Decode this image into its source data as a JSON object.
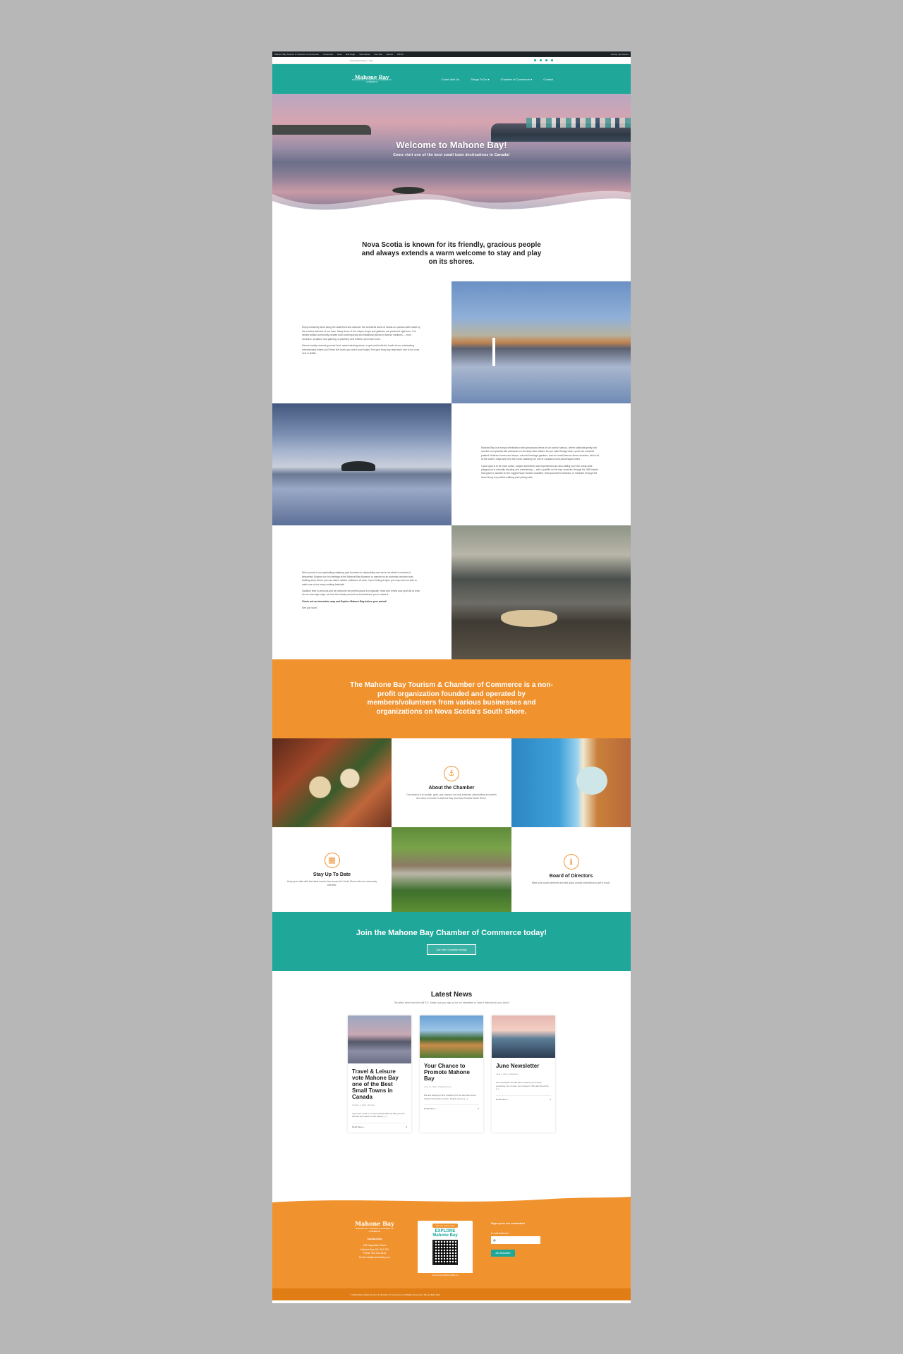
{
  "admin_bar": {
    "site": "Mahone Bay Tourism & Chamber of Commerce",
    "customize": "Customize",
    "new": "New",
    "edit_page": "Edit Page",
    "items": [
      "Visit Cache",
      "Live Site",
      "Events",
      "WPFO"
    ],
    "greeting": "Howdy, Speropoint"
  },
  "topbar": {
    "address": "8 Pleasant Street, 1 Fall"
  },
  "nav": {
    "logo_main": "Mahone Bay",
    "logo_sub": "MAHONE BAY TOURISM & CHAMBER OF COMMERCE",
    "links": [
      "Come Visit Us",
      "Things To Do ▾",
      "Chamber of Commerce ▾",
      "Contact"
    ]
  },
  "hero": {
    "title": "Welcome to Mahone Bay!",
    "subtitle": "Come visit one of the best small town destinations in Canada!"
  },
  "intro": "Nova Scotia is known for its friendly, gracious people and always extends a warm welcome to stay and play on its shores.",
  "section1": {
    "p1": "Enjoy a leisurely stroll along the waterfront and discover the wonderful world of hands-on special crafts made by the creative artisans of our town. Many items of the unique shops and galleries are produced right here. Our vibrant artistic community creates both contemporary and traditional pieces in diverse mediums — from ceramics, sculpture and painting, to jewellery and textiles, and much more.",
    "p2": "Savour locally sourced gourmet food, award-winning wines, or get social with the locals at our outstanding microbrewery where you'll hear live music you won't soon forget. End your busy day relaxing in one of our cozy inns or B&Bs."
  },
  "section2": {
    "p1": "Mahone Bay is a tranquil destination with spectacular views of our scenic harbour, where sailboats gently bob and the sun sparkles like diamonds on the deep blue waters. As you walk through town, you'll see colourful painted Victorian homes and shops, colourful heritage gardens, and our world-famous three churches, which sit at the water's edge and form the iconic backdrop for one of Canada's most picturesque towns.",
    "p2": "If your goal is to be more active, unique adventures and experiences are also calling you! Our ocean-side playground is naturally dazzling and entertaining — sail or paddle on the bay, meander through the 365 islands that grace it, wander on the rugged Nova Scotian coastline, treat yourself to beaches, or meander through the trees along our pristine walking and cycling trails."
  },
  "section3": {
    "p1": "We're proud of our captivating seafaring past founded on shipbuilding and we're not afraid to mention it frequently! Explore our rich heritage at the Mahone Bay Museum or wander by an authentic wooden boat-building shop where you can watch master craftsmen at work. If your timing is right, you may even be able to catch one of our many exciting festivals!",
    "p2": "Vacation time is precious and we welcome the perfect place to invigorate, relax and renew your spirit all at once. As our town sign says, we love the beauty around us and welcome you to share it.",
    "link": "Check out an interactive map and Explore Mahone Bay before your arrival!",
    "signoff": "See you soon!"
  },
  "mission": "The Mahone Bay Tourism & Chamber of Commerce is a non-profit organization founded and operated by members/volunteers from various businesses and organizations on Nova Scotia's South Shore.",
  "features": {
    "about": {
      "title": "About the Chamber",
      "text": "Our mission is to sustain, grow, and connect our local business communities and enrich the value of tourism in Mahone Bay and Nova Scotia's South Shore."
    },
    "stay": {
      "title": "Stay Up To Date",
      "text": "Keep up to date with the latest events from across the South Shore with our community calendar."
    },
    "board": {
      "title": "Board of Directors",
      "text": "Meet your board members and find quick contact information to get in touch."
    }
  },
  "join": {
    "title": "Join the Mahone Bay Chamber of Commerce today!",
    "button": "Join the Chamber today!"
  },
  "news": {
    "title": "Latest News",
    "lead": "The latest news from the MBTCC. Make sure you sign up for our newsletter to have it delivered to your inbox!",
    "posts": [
      {
        "title": "Travel & Leisure vote Mahone Bay one of the Best Small Towns in Canada",
        "meta": "October 3, 2021  |  Tourism",
        "excerpt": "If you live, lived in or have visited Mahone Bay you are already well aware of the beauty [...]",
        "more": "Read More »",
        "comments": "0"
      },
      {
        "title": "Your Chance to Promote Mahone Bay",
        "meta": "June 11, 2021  |  Chamber News",
        "excerpt": "We are looking to fill 2 positions for the summer at our Visitor Information Centre. Details can be [...]",
        "more": "Read More »",
        "comments": "0"
      },
      {
        "title": "June Newsletter",
        "meta": "June 1, 2021  |  Newsletter",
        "excerpt": "Our newsletter should have reached your inbox yesterday, but in case you missed it. We talk about the [...]",
        "more": "Read More »",
        "comments": "0"
      }
    ]
  },
  "footer": {
    "logo_main": "Mahone Bay",
    "logo_sub": "MAHONE BAY TOURISM & CHAMBER OF COMMERCE",
    "contact_title": "Contact Info",
    "address1": "165 Edgewater Street",
    "address2": "Mahone Bay, NS, B0J 2E0",
    "phone": "Phone: 902-624-6151",
    "email": "Email: info@mahonebay.com",
    "qr_top": "Visit our online map!",
    "qr_title1": "EXPLORE",
    "qr_title2": "Mahone Bay",
    "qr_url": "www.ExploreMahoneBay.ca",
    "signup_title": "Sign up for our newsletter!",
    "email_label": "E-mail Address *",
    "email_value": "@",
    "join_button": "Join Newsletter",
    "copyright": "© 2022 Mahone Bay Tourism & Chamber of Commerce  |  All Rights Reserved  |  Site by BHC Web"
  }
}
